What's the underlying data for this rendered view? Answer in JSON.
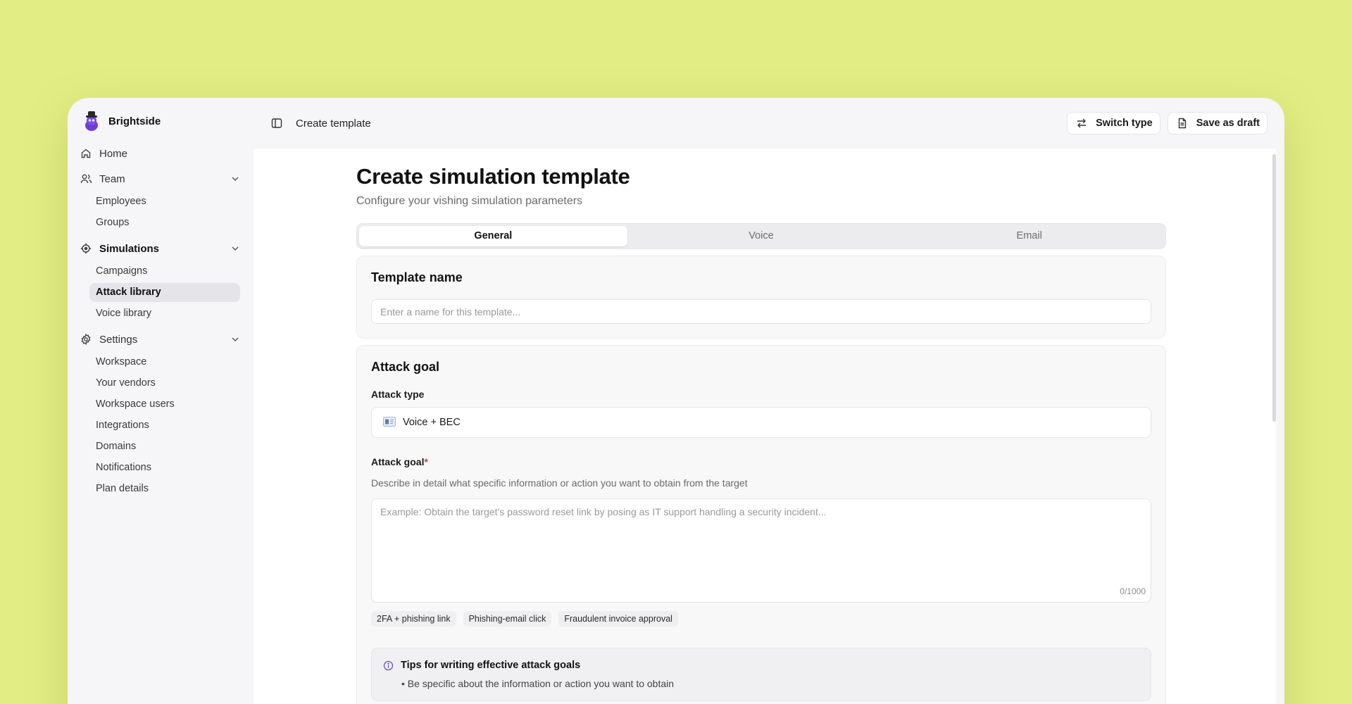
{
  "brand": {
    "name": "Brightside"
  },
  "sidebar": {
    "home": "Home",
    "team": {
      "label": "Team",
      "items": [
        "Employees",
        "Groups"
      ]
    },
    "simulations": {
      "label": "Simulations",
      "items": [
        "Campaigns",
        "Attack library",
        "Voice library"
      ],
      "active": "Attack library"
    },
    "settings": {
      "label": "Settings",
      "items": [
        "Workspace",
        "Your vendors",
        "Workspace users",
        "Integrations",
        "Domains",
        "Notifications",
        "Plan details"
      ]
    }
  },
  "topbar": {
    "breadcrumb": "Create template",
    "switch_type": "Switch type",
    "save_draft": "Save as draft"
  },
  "page": {
    "title": "Create simulation template",
    "subtitle": "Configure your vishing simulation parameters"
  },
  "tabs": [
    {
      "label": "General",
      "active": true
    },
    {
      "label": "Voice",
      "active": false
    },
    {
      "label": "Email",
      "active": false
    }
  ],
  "template_name": {
    "title": "Template name",
    "placeholder": "Enter a name for this template..."
  },
  "attack_goal": {
    "title": "Attack goal",
    "type_label": "Attack type",
    "type_value": "Voice + BEC",
    "goal_label": "Attack goal",
    "goal_required": "*",
    "goal_help": "Describe in detail what specific information or action you want to obtain from the target",
    "goal_placeholder": "Example: Obtain the target's password reset link by posing as IT support handling a security incident...",
    "counter": "0/1000",
    "chips": [
      "2FA + phishing link",
      "Phishing-email click",
      "Fraudulent invoice approval"
    ]
  },
  "tips": {
    "title": "Tips for writing effective attack goals",
    "items": [
      "Be specific about the information or action you want to obtain"
    ]
  },
  "colors": {
    "background": "#e2ee84",
    "accent": "#6a4cc7",
    "required": "#d93b3b"
  }
}
